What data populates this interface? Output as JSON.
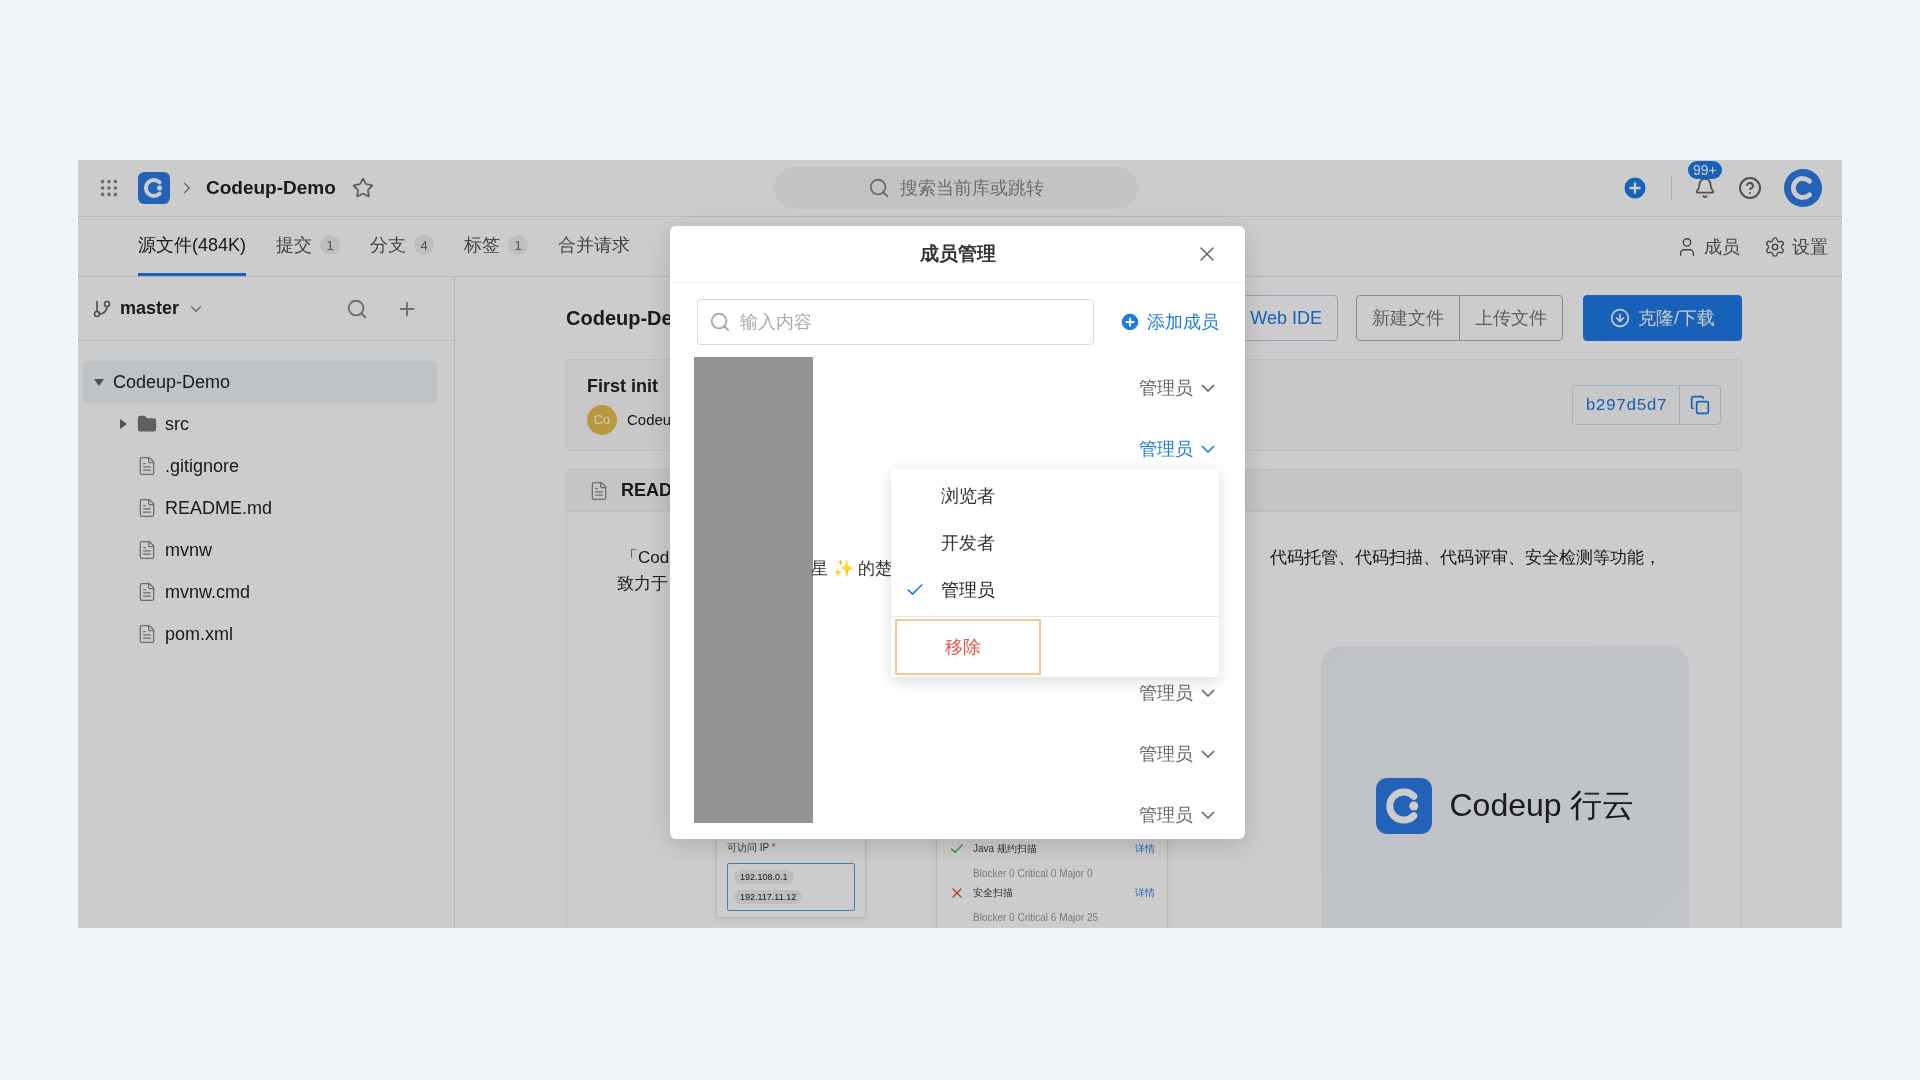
{
  "topbar": {
    "repo": "Codeup-Demo",
    "search_placeholder": "搜索当前库或跳转",
    "notification_badge": "99+"
  },
  "tabs": [
    {
      "label": "源文件(484K)",
      "selected": true
    },
    {
      "label": "提交",
      "count": "1",
      "selected": false
    },
    {
      "label": "分支",
      "count": "4",
      "selected": false
    },
    {
      "label": "标签",
      "count": "1",
      "selected": false
    },
    {
      "label": "合并请求",
      "selected": false
    }
  ],
  "repo_actions": [
    {
      "kind": "members",
      "label": "成员"
    },
    {
      "kind": "settings",
      "label": "设置"
    }
  ],
  "sidebar": {
    "branch": "master",
    "tree": [
      {
        "name": "Codeup-Demo",
        "kind": "folder",
        "expanded": true,
        "selected": true,
        "children": [
          {
            "name": "src",
            "kind": "folder",
            "expanded": false,
            "selected": false
          },
          {
            "name": ".gitignore",
            "kind": "file",
            "selected": false
          },
          {
            "name": "README.md",
            "kind": "file",
            "selected": false
          },
          {
            "name": "mvnw",
            "kind": "file",
            "selected": false
          },
          {
            "name": "mvnw.cmd",
            "kind": "file",
            "selected": false
          },
          {
            "name": "pom.xml",
            "kind": "file",
            "selected": false
          }
        ]
      }
    ]
  },
  "main": {
    "title": "Codeup-De",
    "buttons": [
      {
        "label": "Web IDE",
        "kind": "outline"
      },
      {
        "label": "新建文件",
        "kind": "group"
      },
      {
        "label": "上传文件",
        "kind": "group"
      },
      {
        "label": "克隆/下载",
        "kind": "primary"
      }
    ],
    "commit": {
      "message": "First init",
      "avatar": "Co",
      "author": "Codeu",
      "hash": "b297d5d7"
    },
    "readme": {
      "title": "READ",
      "line1_left": "「Cod",
      "line1_right": "代码托管、代码扫描、代码评审、安全检测等功能，",
      "line2": "致力于",
      "logo_text": "Codeup 行云",
      "ip_label": "可访问 IP",
      "ip_required": "*",
      "ips": [
        "192.108.0.1",
        "192.117.11.12"
      ],
      "scans": [
        {
          "name": "Java 规约扫描",
          "passed": true,
          "link": "详情",
          "stats": "Blocker 0 Critical 0 Major 0"
        },
        {
          "name": "安全扫描",
          "passed": false,
          "link": "详情",
          "stats": "Blocker 0 Critical 6 Major 25"
        }
      ]
    }
  },
  "modal": {
    "title": "成员管理",
    "search_placeholder": "输入内容",
    "add_label": "添加成员",
    "fragment": "星 ✨ 的楚",
    "members": [
      {
        "role": "管理员",
        "open": false
      },
      {
        "role": "管理员",
        "open": true
      },
      {
        "role": "管理员",
        "open": false
      },
      {
        "role": "管理员",
        "open": false
      },
      {
        "role": "管理员",
        "open": false
      }
    ],
    "menu": {
      "options": [
        {
          "label": "浏览者",
          "selected": false
        },
        {
          "label": "开发者",
          "selected": false
        },
        {
          "label": "管理员",
          "selected": true
        }
      ],
      "remove_label": "移除",
      "remove_focused": true
    }
  }
}
